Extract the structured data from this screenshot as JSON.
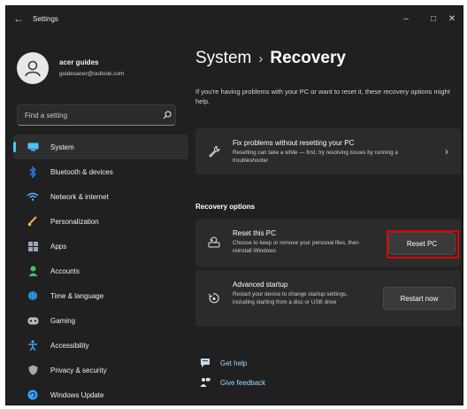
{
  "window": {
    "title": "Settings",
    "back_glyph": "←",
    "minimize_glyph": "–",
    "maximize_glyph": "□",
    "close_glyph": "✕"
  },
  "user": {
    "name": "acer guides",
    "email": "guidesacer@outlook.com"
  },
  "search": {
    "placeholder": "Find a setting",
    "icon": "search-icon"
  },
  "sidebar": {
    "items": [
      {
        "label": "System",
        "icon": "system-icon",
        "color": "#4cc2ff",
        "active": true
      },
      {
        "label": "Bluetooth & devices",
        "icon": "bluetooth-icon",
        "color": "#2a7de1"
      },
      {
        "label": "Network & internet",
        "icon": "wifi-icon",
        "color": "#5bb0ff"
      },
      {
        "label": "Personalization",
        "icon": "brush-icon",
        "color": "#f0b054"
      },
      {
        "label": "Apps",
        "icon": "apps-icon",
        "color": "#9aa7b8"
      },
      {
        "label": "Accounts",
        "icon": "accounts-icon",
        "color": "#45c26b"
      },
      {
        "label": "Time & language",
        "icon": "globe-icon",
        "color": "#2d9be8"
      },
      {
        "label": "Gaming",
        "icon": "gaming-icon",
        "color": "#b9bec5"
      },
      {
        "label": "Accessibility",
        "icon": "accessibility-icon",
        "color": "#46a6ff"
      },
      {
        "label": "Privacy & security",
        "icon": "shield-icon",
        "color": "#a3a9b1"
      },
      {
        "label": "Windows Update",
        "icon": "update-icon",
        "color": "#3aa0ff"
      }
    ]
  },
  "main": {
    "breadcrumb_parent": "System",
    "breadcrumb_sep": "›",
    "breadcrumb_current": "Recovery",
    "intro": "If you're having problems with your PC or want to reset it, these recovery options might help.",
    "fix_card": {
      "title": "Fix problems without resetting your PC",
      "desc": "Resetting can take a while — first, try resolving issues by running a troubleshooter",
      "chevron": "›"
    },
    "section_title": "Recovery options",
    "reset_card": {
      "title": "Reset this PC",
      "desc": "Choose to keep or remove your personal files, then reinstall Windows",
      "button": "Reset PC"
    },
    "advanced_card": {
      "title": "Advanced startup",
      "desc": "Restart your device to change startup settings, including starting from a disc or USB drive",
      "button": "Restart now"
    },
    "links": [
      {
        "label": "Get help",
        "icon": "help-icon"
      },
      {
        "label": "Give feedback",
        "icon": "feedback-icon"
      }
    ]
  },
  "colors": {
    "accent": "#4cc2ff",
    "highlight": "#e00000",
    "background": "#202020",
    "card": "#2b2b2b"
  }
}
